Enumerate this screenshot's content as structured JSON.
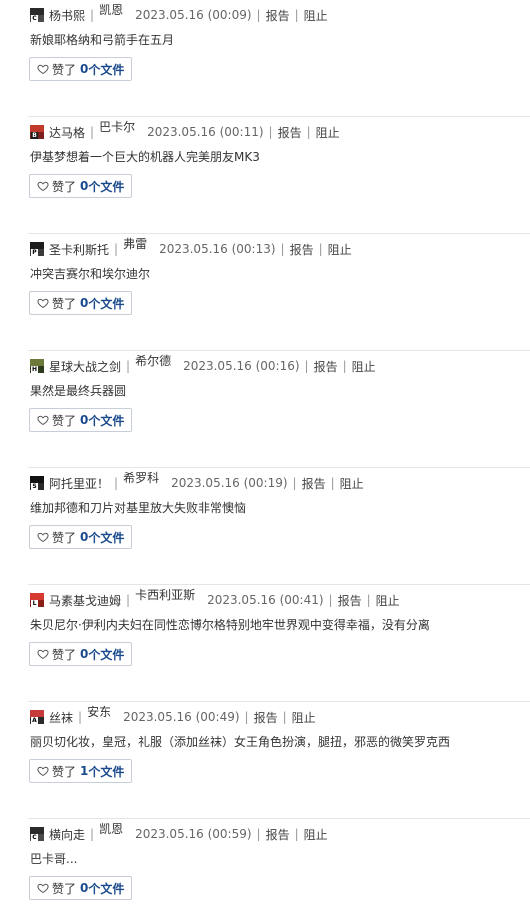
{
  "separator": "|",
  "actions": {
    "report": "报告",
    "block": "阻止"
  },
  "like": {
    "label": "赞了",
    "files_suffix": "个文件"
  },
  "entries": [
    {
      "username": "杨书熙",
      "alias": "凯恩",
      "time": "2023.05.16 (00:09)",
      "text": "新娘耶格纳和弓箭手在五月",
      "likes": "0",
      "avatar": {
        "top": "#2b2b2b",
        "bottom": "#4a4a4a",
        "tag_bg": "#ffffff",
        "tag_color": "#000000",
        "tag": "C"
      }
    },
    {
      "username": "达马格",
      "alias": "巴卡尔",
      "time": "2023.05.16 (00:11)",
      "text": "伊基梦想着一个巨大的机器人完美朋友MK3",
      "likes": "0",
      "avatar": {
        "top": "#c0392b",
        "bottom": "#7b1f1f",
        "tag_bg": "#1d1d1d",
        "tag_color": "#ffffff",
        "tag": "B"
      }
    },
    {
      "username": "圣卡利斯托",
      "alias": "弗雷",
      "time": "2023.05.16 (00:13)",
      "text": "冲突吉赛尔和埃尔迪尔",
      "likes": "0",
      "avatar": {
        "top": "#1c1c1c",
        "bottom": "#3a3a3a",
        "tag_bg": "#ffffff",
        "tag_color": "#000000",
        "tag": "P"
      }
    },
    {
      "username": "星球大战之剑",
      "alias": "希尔德",
      "time": "2023.05.16 (00:16)",
      "text": "果然是最终兵器圆",
      "likes": "0",
      "avatar": {
        "top": "#6b7a3a",
        "bottom": "#2e3b1f",
        "tag_bg": "#ffffff",
        "tag_color": "#000000",
        "tag": "H"
      }
    },
    {
      "username": "阿托里亚！",
      "alias": "希罗科",
      "time": "2023.05.16 (00:19)",
      "text": "维加邦德和刀片对基里放大失败非常懊恼",
      "likes": "0",
      "avatar": {
        "top": "#111111",
        "bottom": "#2a2a2a",
        "tag_bg": "#ffffff",
        "tag_color": "#000000",
        "tag": "S"
      }
    },
    {
      "username": "马素基戈迪姆",
      "alias": "卡西利亚斯",
      "time": "2023.05.16 (00:41)",
      "text": "朱贝尼尔·伊利内夫妇在同性恋博尔格特别地牢世界观中变得幸福，没有分离",
      "likes": "0",
      "avatar": {
        "top": "#d63a2f",
        "bottom": "#8c1f18",
        "tag_bg": "#ffffff",
        "tag_color": "#000000",
        "tag": "L"
      }
    },
    {
      "username": "丝袜",
      "alias": "安东",
      "time": "2023.05.16 (00:49)",
      "text": "丽贝切化妆，皇冠，礼服（添加丝袜）女王角色扮演，腿扭，邪恶的微笑罗克西",
      "likes": "1",
      "avatar": {
        "top": "#c53a3a",
        "bottom": "#2a2a2a",
        "tag_bg": "#ffffff",
        "tag_color": "#000000",
        "tag": "A"
      }
    },
    {
      "username": "横向走",
      "alias": "凯恩",
      "time": "2023.05.16 (00:59)",
      "text": "巴卡哥...",
      "likes": "0",
      "avatar": {
        "top": "#2b2b2b",
        "bottom": "#4a4a4a",
        "tag_bg": "#ffffff",
        "tag_color": "#000000",
        "tag": "C"
      }
    }
  ]
}
